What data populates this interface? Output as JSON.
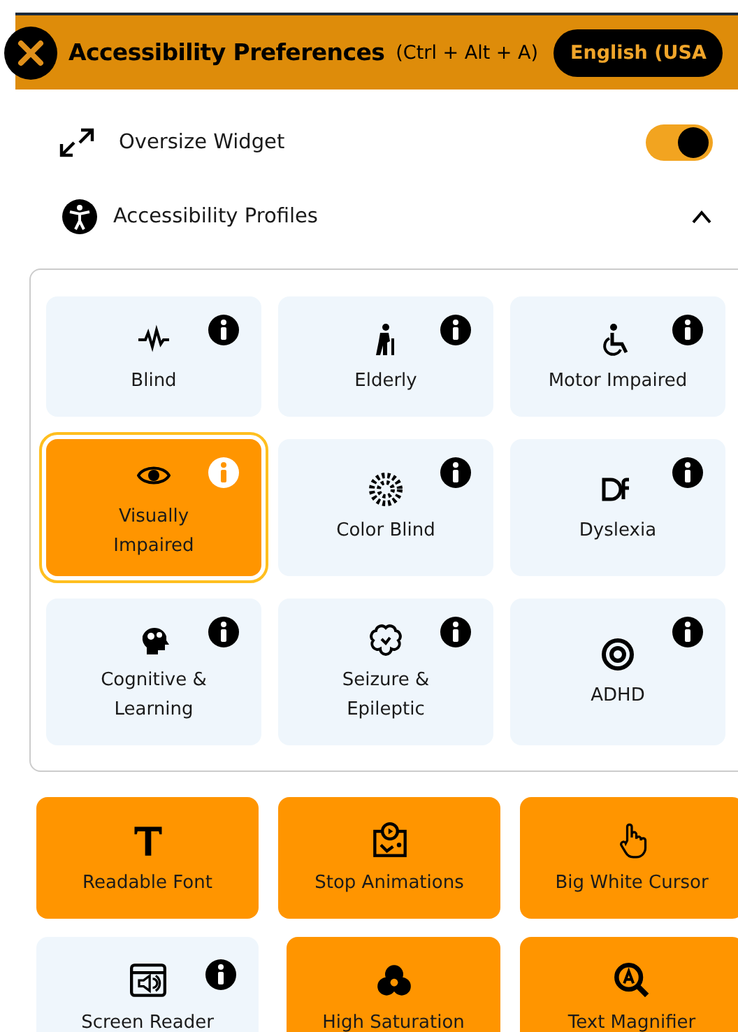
{
  "header": {
    "title": "Accessibility Preferences",
    "shortcut": "(Ctrl + Alt + A)",
    "language": "English (USA"
  },
  "oversize": {
    "label": "Oversize Widget",
    "on": true
  },
  "profiles": {
    "label": "Accessibility Profiles",
    "expanded": true,
    "items": [
      {
        "label": "Blind",
        "selected": false
      },
      {
        "label": "Elderly",
        "selected": false
      },
      {
        "label": "Motor Impaired",
        "selected": false
      },
      {
        "label": "Visually Impaired",
        "selected": true
      },
      {
        "label": "Color Blind",
        "selected": false
      },
      {
        "label": "Dyslexia",
        "selected": false
      },
      {
        "label": "Cognitive & Learning",
        "selected": false
      },
      {
        "label": "Seizure & Epileptic",
        "selected": false
      },
      {
        "label": "ADHD",
        "selected": false
      }
    ]
  },
  "features": [
    {
      "label": "Readable Font",
      "selected": true
    },
    {
      "label": "Stop Animations",
      "selected": true
    },
    {
      "label": "Big White Cursor",
      "selected": true
    },
    {
      "label": "Screen Reader",
      "selected": false
    },
    {
      "label": "High Saturation",
      "selected": true
    },
    {
      "label": "Text Magnifier",
      "selected": true
    }
  ]
}
